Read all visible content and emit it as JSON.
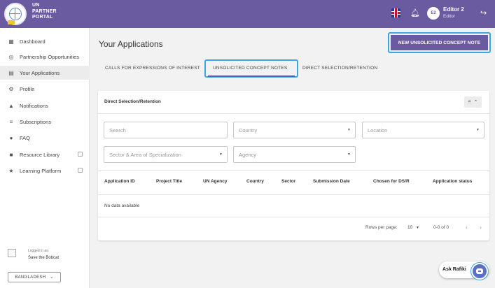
{
  "header": {
    "brand_line1": "UN",
    "brand_line2": "PARTNER",
    "brand_line3": "PORTAL",
    "user_initials": "E2",
    "user_name": "Editor 2",
    "user_role": "Editor",
    "icons": [
      "un-logo-icon",
      "uk-flag-icon",
      "bell-icon",
      "logout-icon"
    ]
  },
  "sidebar": {
    "items": [
      {
        "label": "Dashboard",
        "icon": "dashboard-icon"
      },
      {
        "label": "Partnership Opportunities",
        "icon": "globe-icon"
      },
      {
        "label": "Your Applications",
        "icon": "document-icon"
      },
      {
        "label": "Profile",
        "icon": "gear-icon"
      },
      {
        "label": "Notifications",
        "icon": "bell-icon"
      },
      {
        "label": "Subscriptions",
        "icon": "rss-icon"
      },
      {
        "label": "FAQ",
        "icon": "help-icon"
      },
      {
        "label": "Resource Library",
        "icon": "book-icon"
      },
      {
        "label": "Learning Platform",
        "icon": "star-icon"
      }
    ],
    "logged_in_label": "Logged in as:",
    "logged_in_org": "Save the Bobcat",
    "country_button": "BANGLADESH"
  },
  "main": {
    "title": "Your Applications",
    "new_note_button": "NEW UNSOLICITED CONCEPT NOTE",
    "tabs": [
      {
        "label": "CALLS FOR EXPRESSIONS OF INTEREST"
      },
      {
        "label": "UNSOLICITED CONCEPT NOTES"
      },
      {
        "label": "DIRECT SELECTION/RETENTION"
      }
    ],
    "selected_tab": "UNSOLICITED CONCEPT NOTES"
  },
  "card": {
    "title": "Direct Selection/Retention",
    "filters": {
      "search_placeholder": "Search",
      "country_placeholder": "Country",
      "location_placeholder": "Location",
      "sector_placeholder": "Sector & Area of Specialization",
      "agency_placeholder": "Agency"
    },
    "columns": [
      "Application ID",
      "Project Title",
      "UN Agency",
      "Country",
      "Sector",
      "Submission Date",
      "Chosen for DS/R",
      "Application status"
    ],
    "empty_text": "No data available",
    "pagination": {
      "rows_label": "Rows per page:",
      "rows_value": "10",
      "range": "0-0 of 0"
    }
  },
  "assistant": {
    "label": "Ask Rafiki"
  },
  "colors": {
    "primary": "#6a5a9f",
    "highlight_border": "#3aa7e0",
    "background": "#f2f2f2"
  }
}
